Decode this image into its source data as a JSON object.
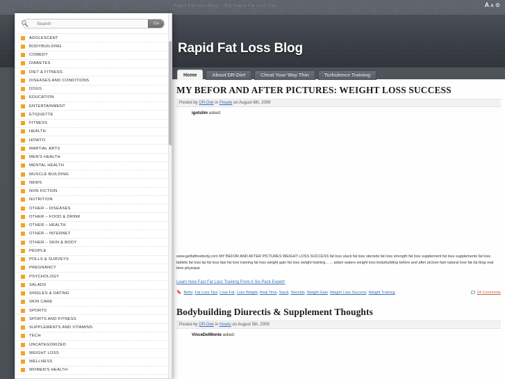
{
  "os_bar": {
    "title": "Rapid Fat Loss Blog :: Top Rapid Fat Loss Tips",
    "font_large": "A",
    "font_small": "A",
    "gear": "⚙"
  },
  "site": {
    "title": "Rapid Fat Loss Blog",
    "tabs": [
      {
        "label": "Home",
        "active": true
      },
      {
        "label": "About DR-Diet",
        "active": false
      },
      {
        "label": "Cheat Your Way Thin",
        "active": false
      },
      {
        "label": "Turbulence Training",
        "active": false
      }
    ]
  },
  "sidebar": {
    "search": {
      "placeholder": "Search",
      "value": "",
      "go_label": "Go"
    },
    "categories": [
      {
        "label": "ADOLESCENT"
      },
      {
        "label": "BODYBUILDING"
      },
      {
        "label": "COMEDY"
      },
      {
        "label": "DIABETES"
      },
      {
        "label": "DIET & FITNESS"
      },
      {
        "label": "DISEASES AND CONDITIONS"
      },
      {
        "label": "DOGS"
      },
      {
        "label": "EDUCATION"
      },
      {
        "label": "ENTERTAINMENT"
      },
      {
        "label": "ETIQUETTE"
      },
      {
        "label": "FITNESS"
      },
      {
        "label": "HEALTH"
      },
      {
        "label": "HOWTO"
      },
      {
        "label": "MARTIAL ARTS"
      },
      {
        "label": "MEN'S HEALTH"
      },
      {
        "label": "MENTAL HEALTH"
      },
      {
        "label": "MUSCLE BUILDING"
      },
      {
        "label": "NEWS"
      },
      {
        "label": "NON FICTION"
      },
      {
        "label": "NUTRITION"
      },
      {
        "label": "OTHER – DISEASES"
      },
      {
        "label": "OTHER – FOOD & DRINK"
      },
      {
        "label": "OTHER – HEALTH"
      },
      {
        "label": "OTHER – INTERNET"
      },
      {
        "label": "OTHER – SKIN & BODY"
      },
      {
        "label": "PEOPLE"
      },
      {
        "label": "POLLS & SURVEYS"
      },
      {
        "label": "PREGNANCY"
      },
      {
        "label": "PSYCHOLOGY"
      },
      {
        "label": "SALADS"
      },
      {
        "label": "SINGLES & DATING"
      },
      {
        "label": "SKIN CARE"
      },
      {
        "label": "SPORTS"
      },
      {
        "label": "SPORTS AND FITNESS"
      },
      {
        "label": "SUPPLEMENTS AND VITAMINS"
      },
      {
        "label": "TECH"
      },
      {
        "label": "UNCATEGORIZED"
      },
      {
        "label": "WEIGHT LOSS"
      },
      {
        "label": "WELLNESS"
      },
      {
        "label": "WOMEN'S HEALTH"
      }
    ]
  },
  "posts": [
    {
      "title": "My Befor and After Pictures: Weight Loss Success",
      "meta_prefix": "Posted by ",
      "author": "DR-Diet",
      "meta_in": " in ",
      "category": "People",
      "meta_date": " on August 6th, 2009",
      "asker_name": "igotslim",
      "asker_suffix": " asked:",
      "body": "www.getfatfreebody.com MY BEFOR AND AFTER PICTURES WEIGHT LOSS SUCCESS fat loss stack fat loss steroids fat loss strength fat loss supplement fat loss supplements fat loss tablets fat loss tip fat loss tips fat loss training fat loss weight gain fat loss weight training... ... adam waters weight loss bodybuilding before and after picture fast natural lose fat rtp blog real time physique",
      "cta": "Learn Now Fast Fat Loss Training From A Six Pack Expert!",
      "tags": [
        "Befor",
        "Fat Loss Tips",
        "Lose Fat",
        "Loss Weight",
        "Real Time",
        "Stack",
        "Steroids",
        "Weight Gain",
        "Weight Loss Success",
        "Weight Training"
      ],
      "comments": "24 Comments"
    },
    {
      "title": "Bodybuilding Diurectis & Supplement Thoughts",
      "meta_prefix": "Posted by ",
      "author": "DR-Diet",
      "meta_in": " in ",
      "category": "Howto",
      "meta_date": " on August 5th, 2009",
      "asker_name": "VinceDelMonte",
      "asker_suffix": " asked:",
      "body": "",
      "cta": "",
      "tags": [],
      "comments": ""
    }
  ],
  "colors": {
    "accent_orange": "#f4a124",
    "link_blue": "#3a6fb5",
    "comment_red": "#c8643c",
    "header_dark": "#3d4149"
  }
}
